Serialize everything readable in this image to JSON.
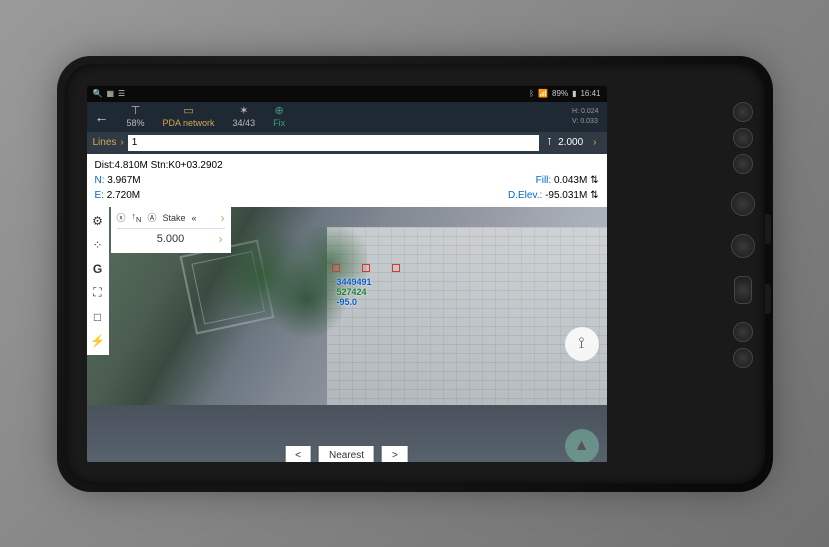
{
  "status": {
    "battery": "89%",
    "time": "16:41"
  },
  "header": {
    "signal": {
      "label": "58%"
    },
    "network": {
      "label": "PDA network"
    },
    "sats": {
      "label": "34/43"
    },
    "fix": {
      "label": "Fix"
    },
    "h": "H: 0.024",
    "v": "V: 0.033"
  },
  "lines": {
    "label": "Lines",
    "value": "1",
    "height": "2.000"
  },
  "info": {
    "dist": "Dist:4.810M Stn:K0+03.2902",
    "n_label": "N:",
    "n": "3.967M",
    "e_label": "E:",
    "e": "2.720M",
    "fill_label": "Fill:",
    "fill": "0.043M",
    "delev_label": "D.Elev.:",
    "delev": "-95.031M"
  },
  "stake": {
    "title": "Stake",
    "value": "5.000"
  },
  "coords": {
    "x": "3449491",
    "y": "527424",
    "z": "-95.0"
  },
  "nav": {
    "prev": "<",
    "label": "Nearest",
    "next": ">"
  }
}
